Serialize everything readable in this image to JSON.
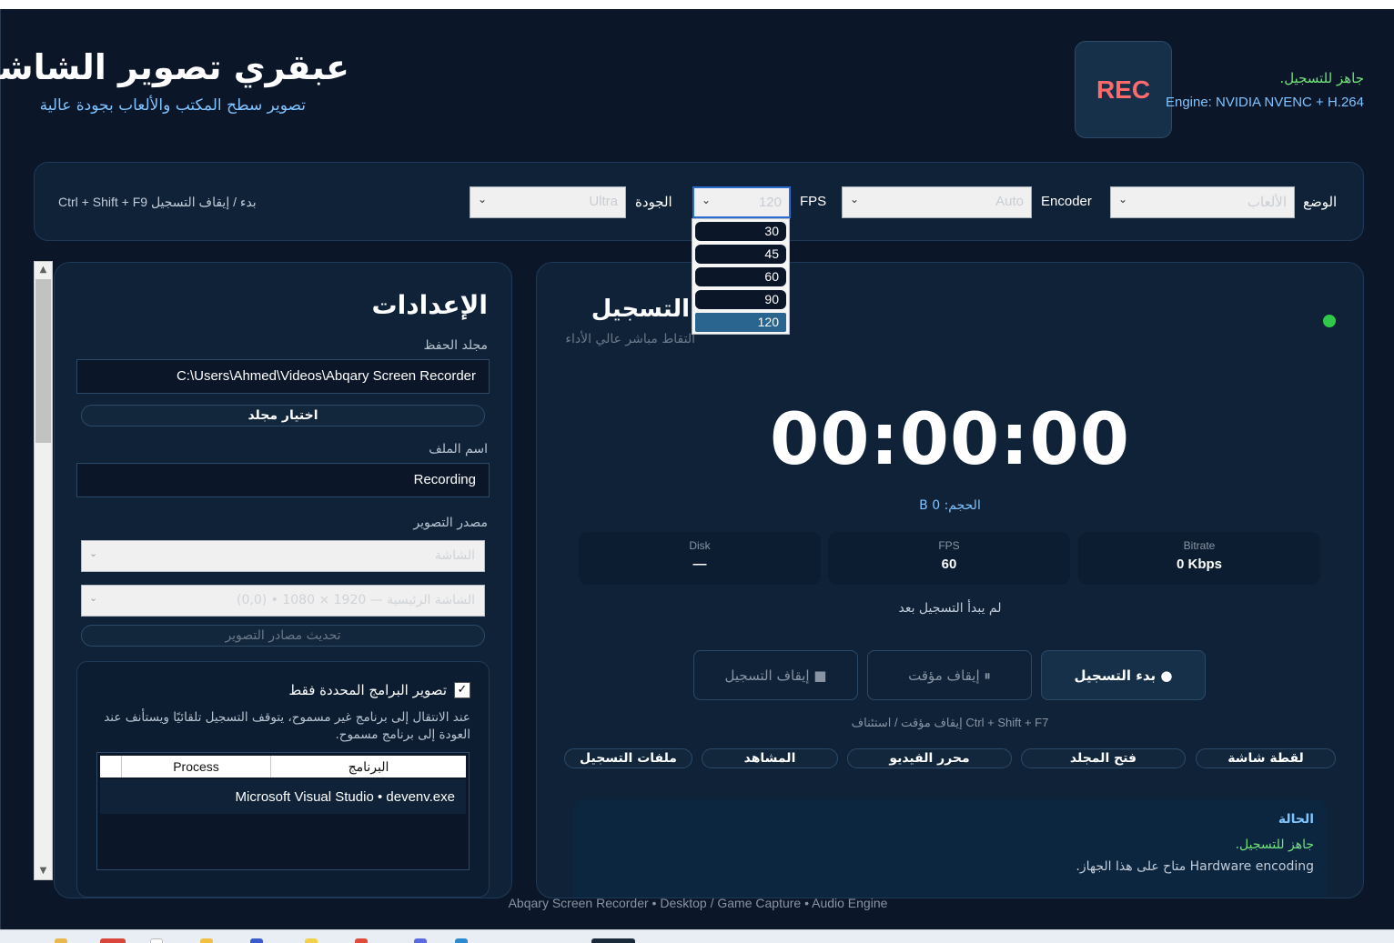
{
  "header": {
    "title": "عبقري تصوير الشاشة",
    "subtitle": "تصوير سطح المكتب والألعاب بجودة عالية",
    "rec_badge": "REC",
    "status": "جاهز للتسجيل.",
    "engine": "Engine: NVIDIA NVENC + H.264"
  },
  "toolbar": {
    "mode_label": "الوضع",
    "mode_value": "الألعاب",
    "encoder_label": "Encoder",
    "encoder_value": "Auto",
    "fps_label": "FPS",
    "fps_value": "120",
    "quality_label": "الجودة",
    "quality_value": "Ultra",
    "hotkey_hint": "Ctrl + Shift + F9 بدء / إيقاف التسجيل",
    "fps_options": [
      "30",
      "45",
      "60",
      "90",
      "120"
    ],
    "fps_selected": "120"
  },
  "settings": {
    "title": "الإعدادات",
    "save_folder_label": "مجلد الحفظ",
    "save_folder_value": "C:\\Users\\Ahmed\\Videos\\Abqary Screen Recorder",
    "choose_folder_button": "اختيار مجلد",
    "filename_label": "اسم الملف",
    "filename_value": "Recording",
    "source_label": "مصدر التصوير",
    "source_value": "الشاشة",
    "display_value": "الشاشة الرئيسية — 1920 × 1080 • (0,0)",
    "refresh_sources_button": "تحديث مصادر التصوير",
    "app_filter": {
      "checkbox_label": "تصوير البرامج المحددة فقط",
      "checked": true,
      "description": "عند الانتقال إلى برنامج غير مسموح، يتوقف التسجيل تلقائيًا ويستأنف عند العودة إلى برنامج مسموح.",
      "columns": [
        "البرنامج",
        "Process"
      ],
      "rows": [
        "Microsoft Visual Studio • devenv.exe"
      ]
    }
  },
  "recording": {
    "title": "التسجيل",
    "subtitle": "التقاط مباشر عالي الأداء",
    "timer": "00:00:00",
    "size": "الحجم: 0 B",
    "stats": [
      {
        "label": "Bitrate",
        "value": "0 Kbps"
      },
      {
        "label": "FPS",
        "value": "60"
      },
      {
        "label": "Disk",
        "value": "—"
      }
    ],
    "not_started": "لم يبدأ التسجيل بعد",
    "start_button": "● بدء التسجيل",
    "pause_button": "⏸ إيقاف مؤقت",
    "stop_button": "■ إيقاف التسجيل",
    "pause_hint": "Ctrl + Shift + F7 إيقاف مؤقت / استئناف",
    "quick_actions": [
      "لقطة شاشة",
      "فتح المجلد",
      "محرر الفيديو",
      "المشاهد",
      "ملفات التسجيل"
    ],
    "status_box": {
      "heading": "الحالة",
      "line1": "جاهز للتسجيل.",
      "line2": "Hardware encoding متاح على هذا الجهاز."
    }
  },
  "footer": "Abqary Screen Recorder • Desktop / Game Capture • Audio Engine",
  "colors": {
    "background": "#0b1628",
    "panel": "#0f2238",
    "accent": "#7fc3ff",
    "ready": "#6fe37a",
    "rec": "#ff6b6b",
    "live_dot": "#31c84a"
  }
}
